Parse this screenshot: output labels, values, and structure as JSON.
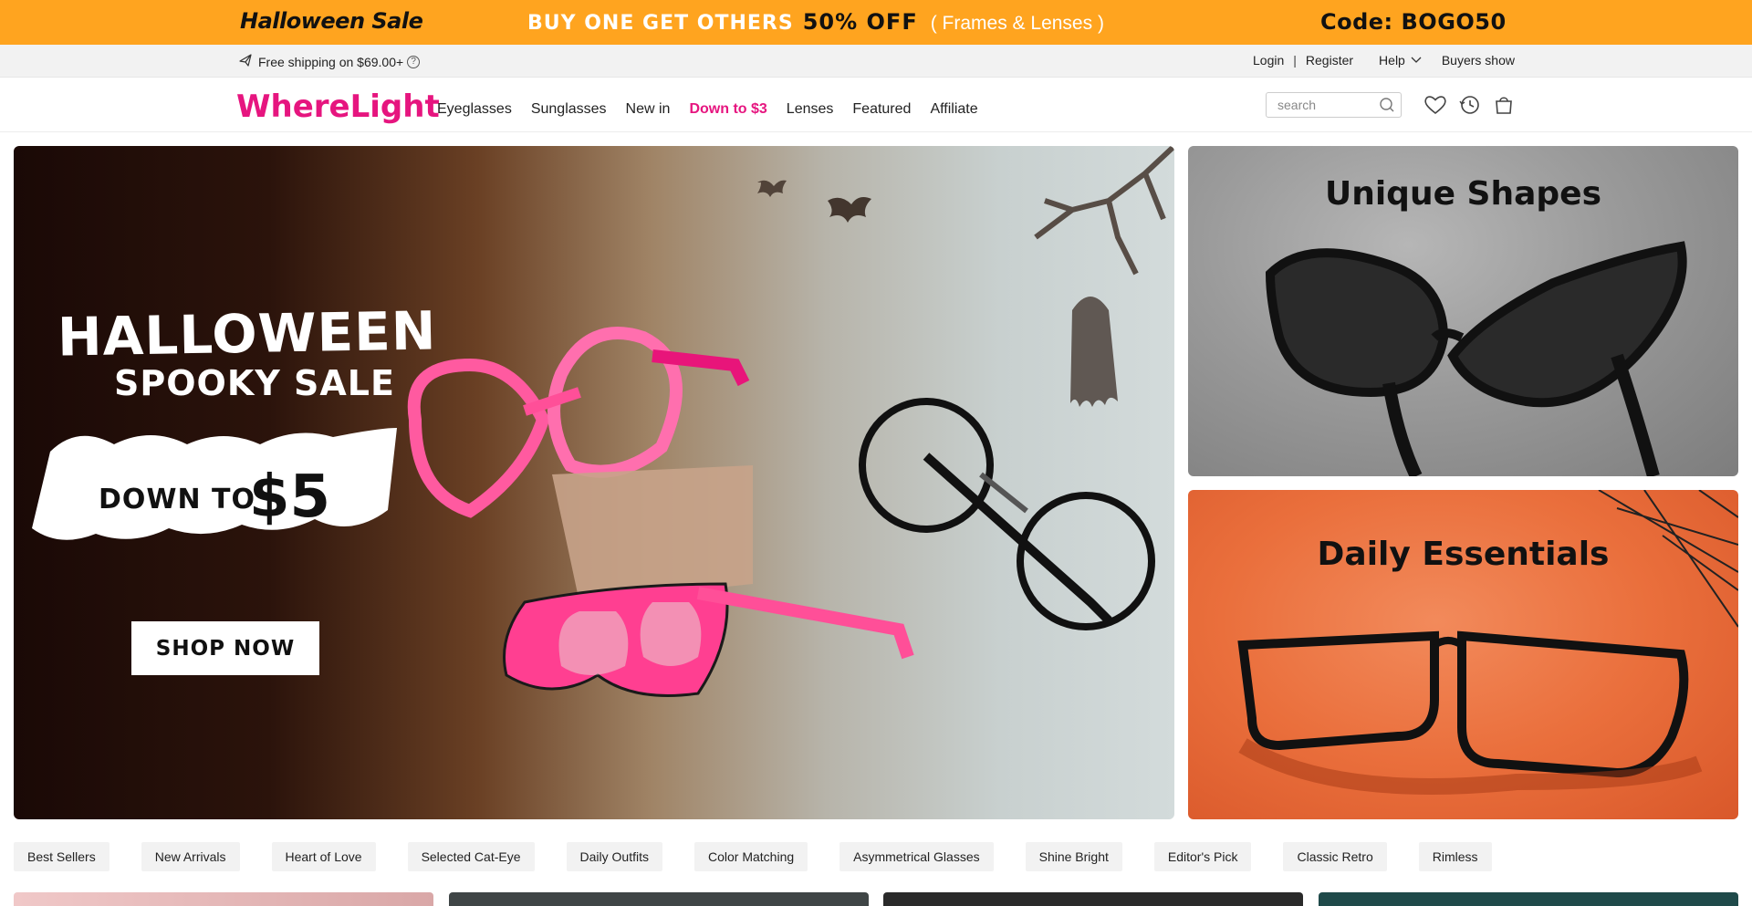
{
  "promo": {
    "left": "Halloween Sale",
    "mid_a": "BUY ONE GET OTHERS",
    "mid_b": "50% OFF",
    "mid_c": "( Frames & Lenses )",
    "code": "Code: BOGO50",
    "bg_color": "#ffa41f"
  },
  "utility": {
    "shipping": "Free shipping on $69.00+",
    "login": "Login",
    "separator": "|",
    "register": "Register",
    "help": "Help",
    "buyers_show": "Buyers show"
  },
  "header": {
    "logo": "WhereLight",
    "brand_color": "#e6157f",
    "nav": [
      "Eyeglasses",
      "Sunglasses",
      "New in",
      "Down to $3",
      "Lenses",
      "Featured",
      "Affiliate"
    ],
    "search_placeholder": "search",
    "icons": [
      "heart-icon",
      "history-icon",
      "cart-icon"
    ]
  },
  "hero": {
    "title1": "HALLOWEEN",
    "title2": "SPOOKY SALE",
    "down_to": "DOWN TO",
    "price": "$5",
    "cta": "SHOP NOW"
  },
  "side_banners": [
    {
      "title": "Unique Shapes"
    },
    {
      "title": "Daily Essentials"
    }
  ],
  "categories": [
    "Best Sellers",
    "New Arrivals",
    "Heart of Love",
    "Selected Cat-Eye",
    "Daily Outfits",
    "Color Matching",
    "Asymmetrical Glasses",
    "Shine Bright",
    "Editor's Pick",
    "Classic Retro",
    "Rimless"
  ]
}
